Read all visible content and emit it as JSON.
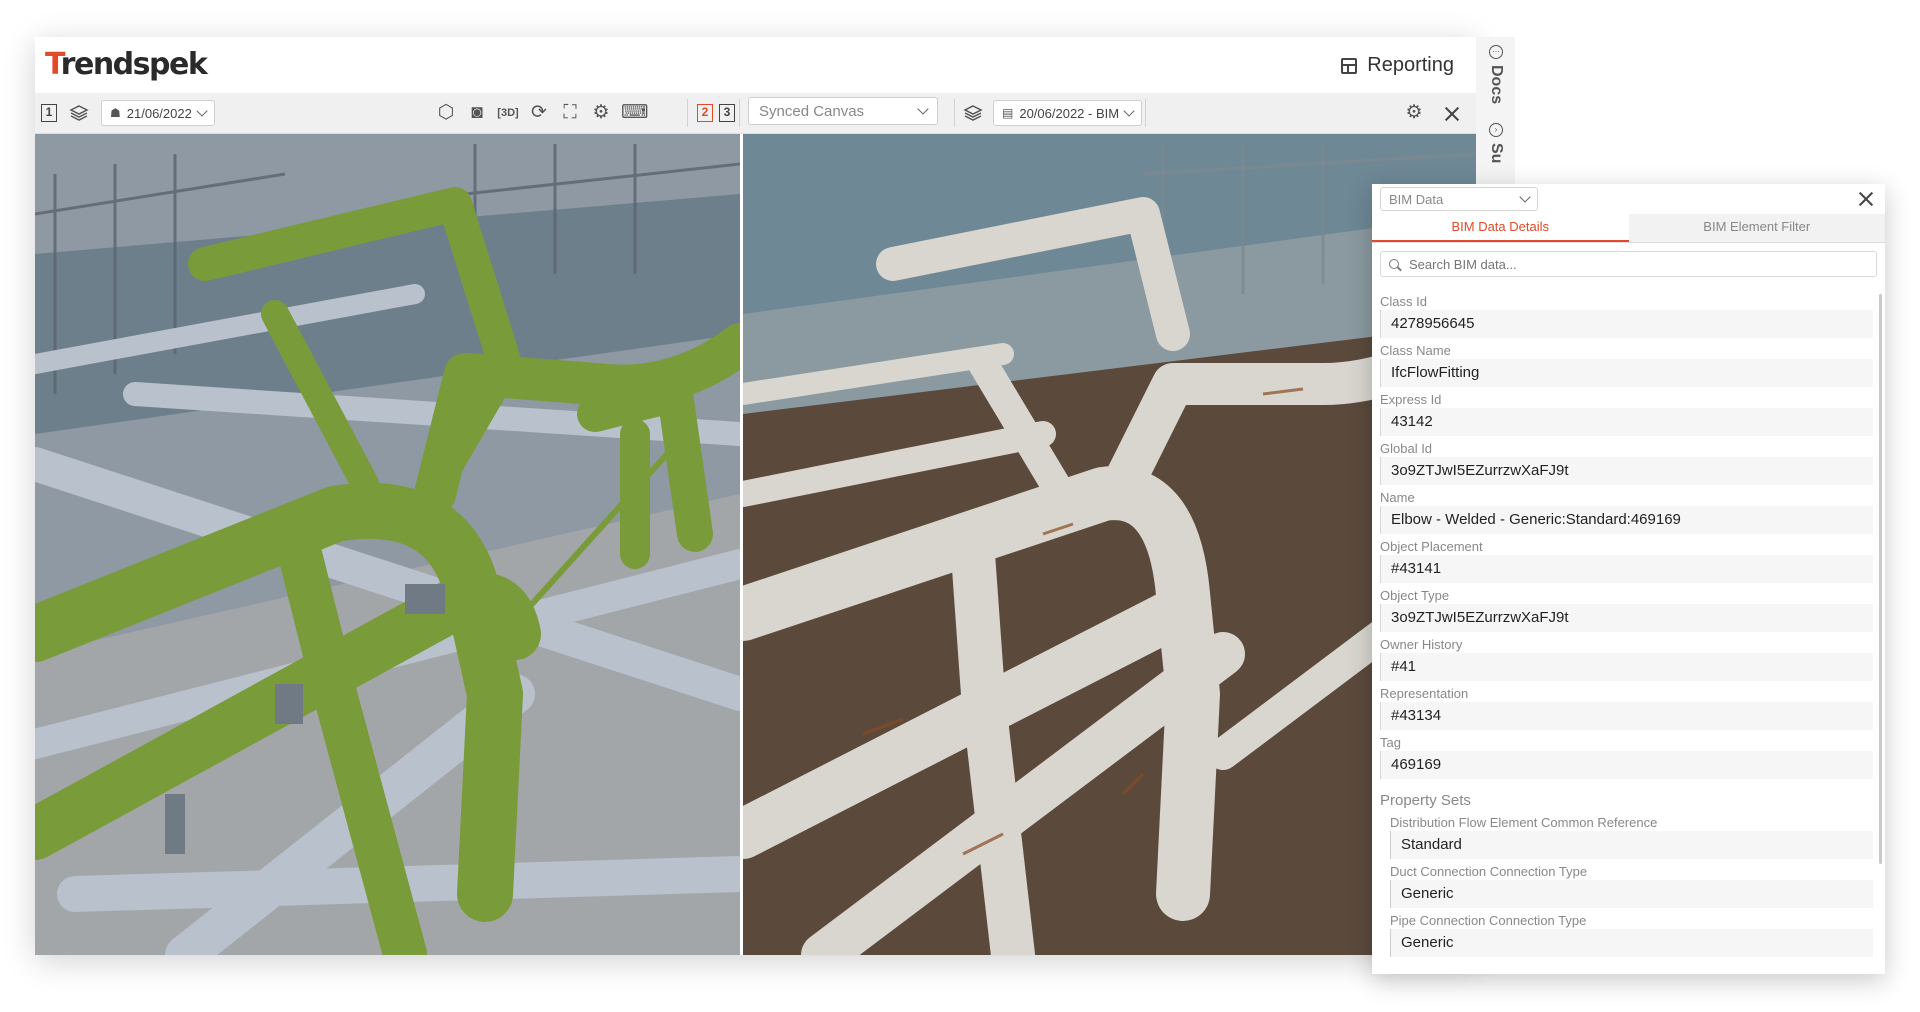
{
  "app": {
    "logo": "Trendspek",
    "reporting_label": "Reporting",
    "side_tabs": [
      "Docs",
      "Su"
    ]
  },
  "toolbar": {
    "left_canvas_number": "1",
    "left_date": "21/06/2022",
    "canvas_numbers": [
      "2",
      "3"
    ],
    "synced_canvas": "Synced Canvas",
    "right_date": "20/06/2022 - BIM"
  },
  "bim_panel": {
    "select_label": "BIM Data",
    "tabs": [
      "BIM Data Details",
      "BIM Element Filter"
    ],
    "search_placeholder": "Search BIM data...",
    "fields": [
      {
        "label": "Class Id",
        "value": "4278956645"
      },
      {
        "label": "Class Name",
        "value": "IfcFlowFitting"
      },
      {
        "label": "Express Id",
        "value": "43142"
      },
      {
        "label": "Global Id",
        "value": "3o9ZTJwI5EZurrzwXaFJ9t"
      },
      {
        "label": "Name",
        "value": "Elbow - Welded - Generic:Standard:469169"
      },
      {
        "label": "Object Placement",
        "value": "#43141"
      },
      {
        "label": "Object Type",
        "value": "3o9ZTJwI5EZurrzwXaFJ9t"
      },
      {
        "label": "Owner History",
        "value": "#41"
      },
      {
        "label": "Representation",
        "value": "#43134"
      },
      {
        "label": "Tag",
        "value": "469169"
      }
    ],
    "property_sets_title": "Property Sets",
    "property_sets": [
      {
        "label": "Distribution Flow Element Common Reference",
        "value": "Standard"
      },
      {
        "label": "Duct Connection Connection Type",
        "value": "Generic"
      },
      {
        "label": "Pipe Connection Connection Type",
        "value": "Generic"
      }
    ]
  },
  "colors": {
    "accent": "#e24a2a",
    "bim_model_pipe": "#7a9b3a",
    "scan_pipe": "#d8d6cf"
  }
}
